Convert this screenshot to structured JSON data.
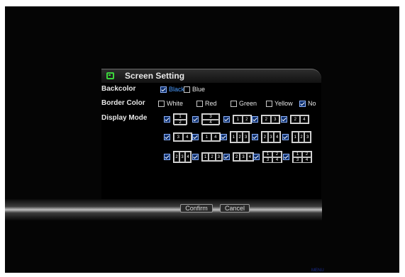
{
  "window": {
    "title": "Screen Setting"
  },
  "backcolor": {
    "label": "Backcolor",
    "options": [
      {
        "label": "Black",
        "checked": true
      },
      {
        "label": "Blue",
        "checked": false
      }
    ]
  },
  "border_color": {
    "label": "Border Color",
    "options": [
      {
        "label": "White",
        "checked": false
      },
      {
        "label": "Red",
        "checked": false
      },
      {
        "label": "Green",
        "checked": false
      },
      {
        "label": "Yellow",
        "checked": false
      },
      {
        "label": "No",
        "checked": true
      }
    ]
  },
  "display_mode": {
    "label": "Display Mode",
    "modes": [
      {
        "cells": [
          "1",
          "2"
        ]
      },
      {
        "cells": [
          "3",
          "4"
        ]
      },
      {
        "cells": [
          "1",
          "2"
        ]
      },
      {
        "cells": [
          "2",
          "3"
        ]
      },
      {
        "cells": [
          "2",
          "4"
        ]
      },
      {
        "cells": [
          "3",
          "4"
        ]
      },
      {
        "cells": [
          "1",
          "4"
        ]
      },
      {
        "cells": [
          "1",
          "2",
          "3"
        ]
      },
      {
        "cells": [
          "2",
          "3",
          "4"
        ]
      },
      {
        "cells": [
          "1",
          "2",
          "3"
        ]
      },
      {
        "cells": [
          "2",
          "3",
          "4"
        ]
      },
      {
        "cells": [
          "1",
          "2",
          "3"
        ]
      },
      {
        "cells": [
          "2",
          "3",
          "4"
        ]
      },
      {
        "cells": [
          "1",
          "2",
          "3",
          "4"
        ]
      },
      {
        "cells": [
          "1",
          "2",
          "3",
          "4"
        ]
      }
    ]
  },
  "buttons": {
    "confirm": "Confirm",
    "cancel": "Cancel"
  },
  "taskbar": [
    "MENU"
  ]
}
